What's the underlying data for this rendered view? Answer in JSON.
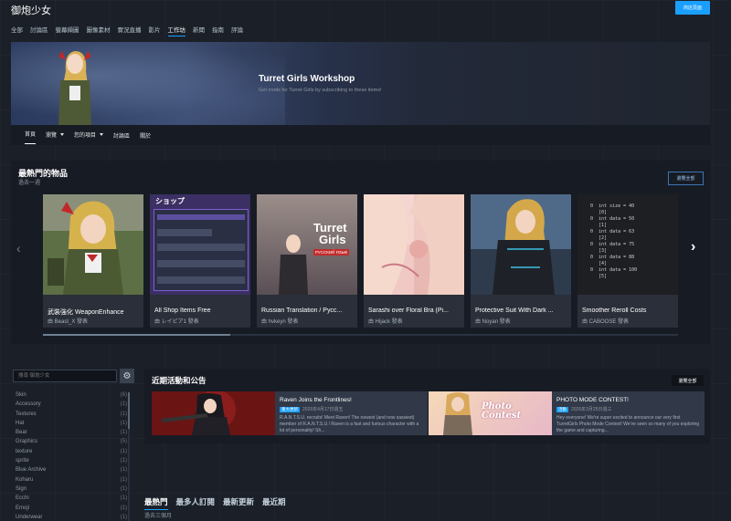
{
  "app": {
    "title": "御炮少女",
    "store_button": "商店頁面"
  },
  "nav": [
    "全部",
    "討論區",
    "螢幕擷圖",
    "圖像素材",
    "實況直播",
    "影片",
    "工作坊",
    "新聞",
    "指南",
    "評論"
  ],
  "banner": {
    "title": "Turret Girls Workshop",
    "description": "Get mods for Turret Girls by subscribing to these items!"
  },
  "subnav": [
    "首頁",
    "瀏覽",
    "您的項目",
    "討論區",
    "關於"
  ],
  "popular": {
    "title": "最熱門的物品",
    "subtitle": "過去一週",
    "browse_all": "瀏覽全部",
    "items": [
      {
        "title": "武裝強化 WeaponEnhance",
        "author": "由 Beast_X 發表"
      },
      {
        "title": "All Shop Items Free",
        "author": "由 レイピア1 發表"
      },
      {
        "title": "Russian Translation / Русс...",
        "author": "由 hvkeyn 發表"
      },
      {
        "title": "Sarashi over Floral Bra (Pi...",
        "author": "由 Hijack 發表"
      },
      {
        "title": "Protective Suit With Dark ...",
        "author": "由 Noyan 發表"
      },
      {
        "title": "Smoother Reroll Costs",
        "author": "由 CABOOSE 發表"
      }
    ],
    "shop_label": "ショップ",
    "russian_logo": [
      "Turret",
      "Girls"
    ],
    "russian_sub": "РУССКИЙ ЯЗЫК",
    "code_lines": [
      "0  int size = 40",
      "   [0]",
      "0  int data = 50",
      "   [1]",
      "0  int data = 63",
      "   [2]",
      "0  int data = 75",
      "   [3]",
      "0  int data = 88",
      "   [4]",
      "0  int data = 100",
      "   [5]"
    ]
  },
  "sidebar": {
    "search_placeholder": "搜尋 御炮少女",
    "tags": [
      {
        "name": "Skin",
        "count": "(6)"
      },
      {
        "name": "Accessory",
        "count": "(1)"
      },
      {
        "name": "Textures",
        "count": "(1)"
      },
      {
        "name": "Hat",
        "count": "(1)"
      },
      {
        "name": "Bear",
        "count": "(1)"
      },
      {
        "name": "Graphics",
        "count": "(5)"
      },
      {
        "name": "texture",
        "count": "(1)"
      },
      {
        "name": "sprite",
        "count": "(1)"
      },
      {
        "name": "Blue Archive",
        "count": "(1)"
      },
      {
        "name": "Koharu",
        "count": "(1)"
      },
      {
        "name": "Sign",
        "count": "(1)"
      },
      {
        "name": "Ecchi",
        "count": "(1)"
      },
      {
        "name": "Emoji",
        "count": "(1)"
      },
      {
        "name": "Underwear",
        "count": "(1)"
      }
    ]
  },
  "events": {
    "title": "近期活動和公告",
    "view_all": "瀏覽全部",
    "items": [
      {
        "title": "Raven Joins the Frontlines!",
        "badge": "重大更新",
        "date": "2026年4月17日週五",
        "desc": "R.A.N.T.S.U. recruits! Meet Raven! The newest (and now sassiest) member of R.A.N.T.S.U.! Raven is a fast and furious character with a lot of personality! Sh..."
      },
      {
        "title": "PHOTO MODE CONTEST!",
        "badge": "活動",
        "date": "2026年3月25日週三",
        "desc": "Hey everyone! We're super excited to announce our very first TurretGirls Photo Mode Contest! We've seen so many of you exploring the game and capturing..."
      }
    ],
    "photo_contest_art": "Photo Contest"
  },
  "bottom_tabs": [
    "最熱門",
    "最多人訂閱",
    "最新更新",
    "最近期"
  ],
  "bottom_sub": "過去三個月",
  "colors": {
    "accent": "#1a9fff",
    "background": "#1b2028",
    "panel": "#161b23"
  }
}
